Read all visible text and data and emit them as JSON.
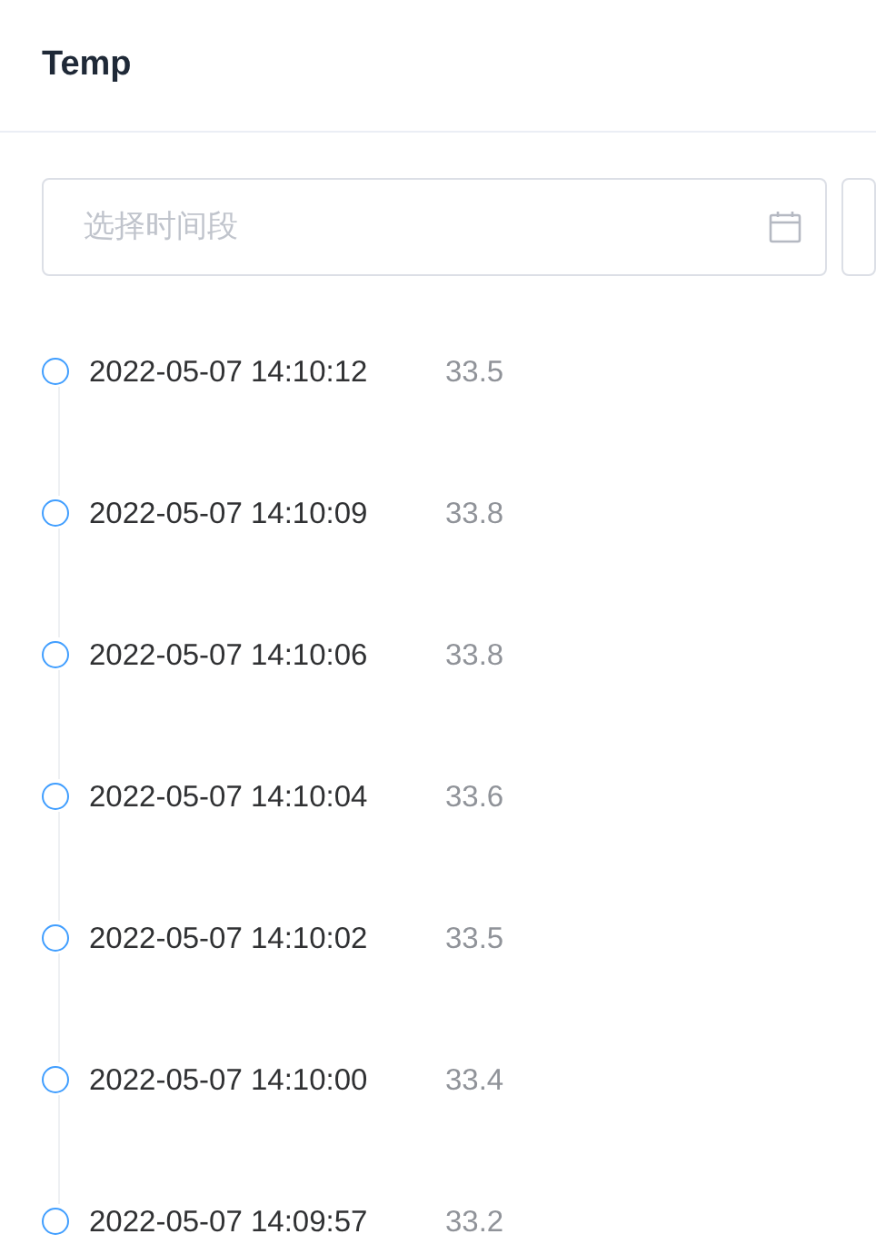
{
  "header": {
    "title": "Temp"
  },
  "date_range": {
    "placeholder": "选择时间段"
  },
  "timeline": [
    {
      "time": "2022-05-07 14:10:12",
      "value": "33.5"
    },
    {
      "time": "2022-05-07 14:10:09",
      "value": "33.8"
    },
    {
      "time": "2022-05-07 14:10:06",
      "value": "33.8"
    },
    {
      "time": "2022-05-07 14:10:04",
      "value": "33.6"
    },
    {
      "time": "2022-05-07 14:10:02",
      "value": "33.5"
    },
    {
      "time": "2022-05-07 14:10:00",
      "value": "33.4"
    },
    {
      "time": "2022-05-07 14:09:57",
      "value": "33.2"
    }
  ]
}
